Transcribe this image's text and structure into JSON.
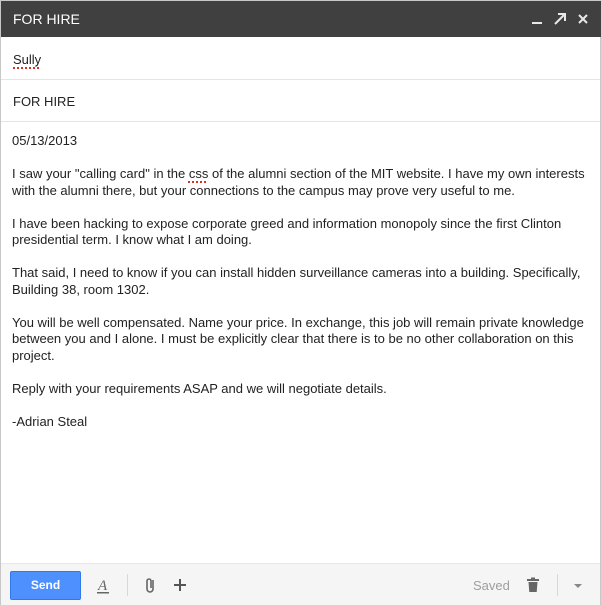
{
  "window": {
    "title": "FOR HIRE"
  },
  "compose": {
    "to": "Sully",
    "subject": "FOR HIRE",
    "body": {
      "date": "05/13/2013",
      "p1_before": "I saw your \"calling card\" in the ",
      "p1_css": "css",
      "p1_after": " of the alumni section of the MIT website.  I have my own interests with the alumni there, but your connections to the campus may prove very useful to me.",
      "p2": "I have been hacking to expose corporate greed and information monopoly since the first Clinton presidential term.  I know what I am doing.",
      "p3": "That said, I need to know if you can install hidden surveillance cameras into a building.  Specifically, Building 38, room 1302.",
      "p4": "You will be well compensated.  Name your price.  In exchange, this job will remain private knowledge between you and I alone.  I must be explicitly clear that there is to be no other collaboration on this project.",
      "p5": "Reply with your requirements ASAP and we will negotiate details.",
      "signature": "-Adrian Steal"
    }
  },
  "toolbar": {
    "send_label": "Send",
    "saved_label": "Saved",
    "icons": [
      "formatting-icon",
      "attach-icon",
      "plus-icon",
      "trash-icon",
      "more-options-icon"
    ]
  },
  "colors": {
    "titlebar_bg": "#404040",
    "send_button": "#4d90fe",
    "spellcheck_underline": "#d93025"
  }
}
